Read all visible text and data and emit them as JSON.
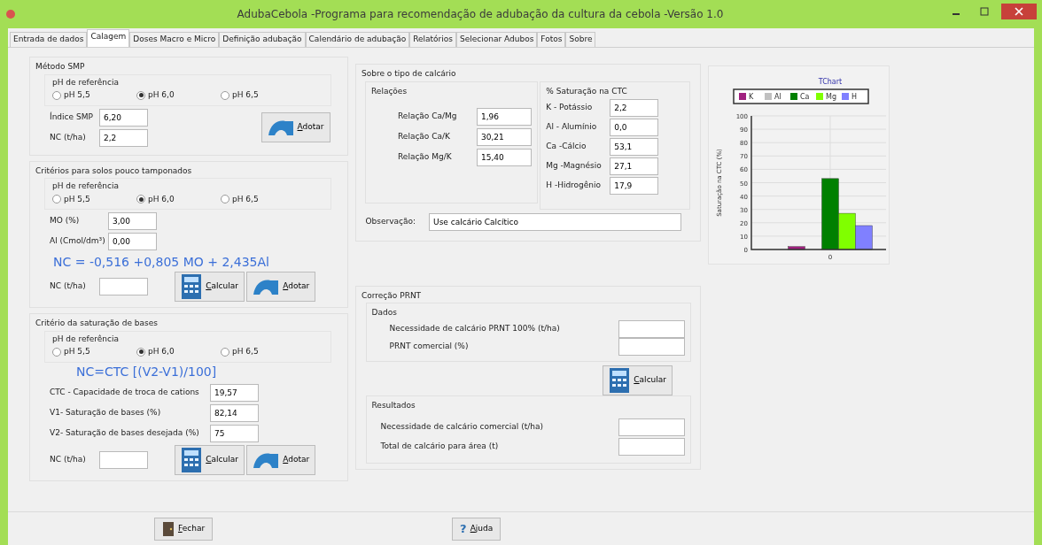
{
  "window": {
    "title": "AdubaCebola -Programa para recomendação de adubação da cultura da cebola -Versão 1.0"
  },
  "tabs": [
    {
      "label": "Entrada de dados",
      "selected": false
    },
    {
      "label": "Calagem",
      "selected": true
    },
    {
      "label": "Doses Macro e Micro",
      "selected": false
    },
    {
      "label": "Definição adubação",
      "selected": false
    },
    {
      "label": "Calendário de adubação",
      "selected": false
    },
    {
      "label": "Relatórios",
      "selected": false
    },
    {
      "label": "Selecionar Adubos",
      "selected": false
    },
    {
      "label": "Fotos",
      "selected": false
    },
    {
      "label": "Sobre",
      "selected": false
    }
  ],
  "panels": [
    {
      "title": "Método SMP",
      "ph_group": {
        "title": "pH de referência",
        "options": [
          {
            "label": "pH 5,5",
            "selected": false
          },
          {
            "label": "pH 6,0",
            "selected": true
          },
          {
            "label": "pH 6,5",
            "selected": false
          }
        ]
      },
      "fields": [
        {
          "label": "Índice SMP",
          "value": "6,20"
        },
        {
          "label": "NC (t/ha)",
          "value": "2,2"
        }
      ],
      "buttons": [
        {
          "kind": "adotar",
          "label": "Adotar"
        }
      ]
    },
    {
      "title": "Critérios para solos pouco tamponados",
      "ph_group": {
        "title": "pH de referência",
        "options": [
          {
            "label": "pH 5,5",
            "selected": false
          },
          {
            "label": "pH 6,0",
            "selected": true
          },
          {
            "label": "pH 6,5",
            "selected": false
          }
        ]
      },
      "fields": [
        {
          "label": "MO  (%)",
          "value": "3,00"
        },
        {
          "label": "Al (Cmol/dm³)",
          "value": "0,00"
        }
      ],
      "formula": "NC = -0,516 +0,805 MO + 2,435Al",
      "result_field": {
        "label": "NC (t/ha)"
      },
      "buttons": [
        {
          "kind": "calcular",
          "label": "Calcular"
        },
        {
          "kind": "adotar",
          "label": "Adotar"
        }
      ]
    },
    {
      "title": "Critério da saturação de bases",
      "ph_group": {
        "title": "pH de referência",
        "options": [
          {
            "label": "pH 5,5",
            "selected": false
          },
          {
            "label": "pH 6,0",
            "selected": true
          },
          {
            "label": "pH 6,5",
            "selected": false
          }
        ]
      },
      "formula": "NC=CTC [(V2-V1)/100]",
      "fields": [
        {
          "label": "CTC - Capacidade de troca de cations",
          "value": "19,57"
        },
        {
          "label": "V1- Saturação de bases (%)",
          "value": "82,14"
        },
        {
          "label": "V2- Saturação de bases desejada (%)",
          "value": "75"
        }
      ],
      "result_field": {
        "label": "NC (t/ha)"
      },
      "buttons": [
        {
          "kind": "calcular",
          "label": "Calcular"
        },
        {
          "kind": "adotar",
          "label": "Adotar"
        }
      ]
    }
  ],
  "calcario": {
    "title": "Sobre o tipo de calcário",
    "relacoes": {
      "title": "Relações",
      "fields": [
        {
          "label": "Relação Ca/Mg",
          "value": "1,96"
        },
        {
          "label": "Relação Ca/K",
          "value": "30,21"
        },
        {
          "label": "Relação Mg/K",
          "value": "15,40"
        }
      ]
    },
    "saturacao_ctc": {
      "title": "% Saturação na CTC",
      "fields": [
        {
          "label": "K - Potássio",
          "value": "2,2"
        },
        {
          "label": "Al - Alumínio",
          "value": "0,0"
        },
        {
          "label": "Ca -Cálcio",
          "value": "53,1"
        },
        {
          "label": "Mg -Magnésio",
          "value": "27,1"
        },
        {
          "label": "H -Hidrogênio",
          "value": "17,9"
        }
      ]
    },
    "observacao": {
      "label": "Observação:",
      "value": "Use calcário Calcítico"
    }
  },
  "prnt": {
    "title": "Correção PRNT",
    "dados": {
      "title": "Dados",
      "fields": [
        {
          "label": "Necessidade de  calcário PRNT 100% (t/ha)"
        },
        {
          "label": "PRNT  comercial  (%)"
        }
      ]
    },
    "button": {
      "kind": "calcular",
      "label": "Calcular"
    },
    "resultados": {
      "title": "Resultados",
      "fields": [
        {
          "label": "Necessidade de calcário comercial (t/ha)"
        },
        {
          "label": "Total de calcário para área (t)"
        }
      ]
    }
  },
  "chart": {
    "chart_data": {
      "type": "bar",
      "title": "TChart",
      "ylabel": "Saturação na CTC (%)",
      "categories": [
        "0"
      ],
      "series": [
        {
          "name": "K",
          "color": "#a0207f",
          "values": [
            2.2
          ]
        },
        {
          "name": "Al",
          "color": "#c0c0c0",
          "values": [
            0
          ]
        },
        {
          "name": "Ca",
          "color": "#008000",
          "values": [
            53.1
          ]
        },
        {
          "name": "Mg",
          "color": "#80ff00",
          "values": [
            27.1
          ]
        },
        {
          "name": "H",
          "color": "#8080ff",
          "values": [
            17.9
          ]
        }
      ],
      "grid": true,
      "legend": true,
      "ylim": [
        0,
        100
      ],
      "yticks": [
        0,
        10,
        20,
        30,
        40,
        50,
        60,
        70,
        80,
        90,
        100
      ]
    }
  },
  "footer_buttons": [
    {
      "kind": "fechar",
      "label": "Fechar"
    },
    {
      "kind": "ajuda",
      "icon": "?",
      "label": "Ajuda"
    }
  ]
}
